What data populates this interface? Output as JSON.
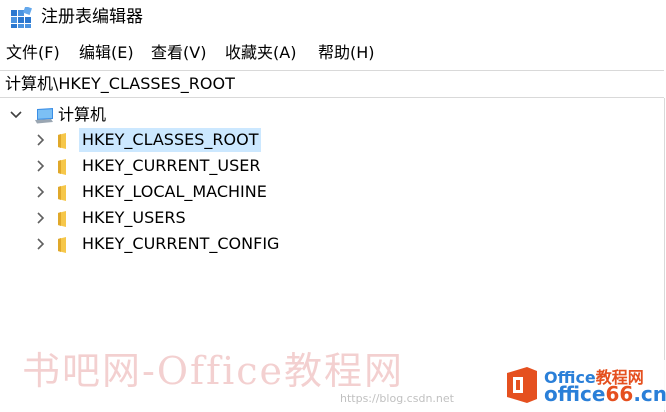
{
  "window": {
    "title": "注册表编辑器"
  },
  "menu": {
    "items": [
      "文件(F)",
      "编辑(E)",
      "查看(V)",
      "收藏夹(A)",
      "帮助(H)"
    ]
  },
  "address": {
    "value": "计算机\\HKEY_CLASSES_ROOT"
  },
  "tree": {
    "root_label": "计算机",
    "keys": [
      {
        "label": "HKEY_CLASSES_ROOT",
        "selected": true
      },
      {
        "label": "HKEY_CURRENT_USER",
        "selected": false
      },
      {
        "label": "HKEY_LOCAL_MACHINE",
        "selected": false
      },
      {
        "label": "HKEY_USERS",
        "selected": false
      },
      {
        "label": "HKEY_CURRENT_CONFIG",
        "selected": false
      }
    ]
  },
  "watermark": {
    "text": "书吧网-Office教程网",
    "url": "https://blog.csdn.net",
    "logo_top_latin": "Office",
    "logo_top_cn": "教程网",
    "logo_bottom_word": "office",
    "logo_bottom_num": "66",
    "logo_bottom_tld": ".cn"
  },
  "colors": {
    "selection": "#cce8ff",
    "folder": "#f6c74a",
    "chevron": "#606060",
    "brand_blue": "#2a7fd8",
    "brand_orange": "#e5501f"
  }
}
